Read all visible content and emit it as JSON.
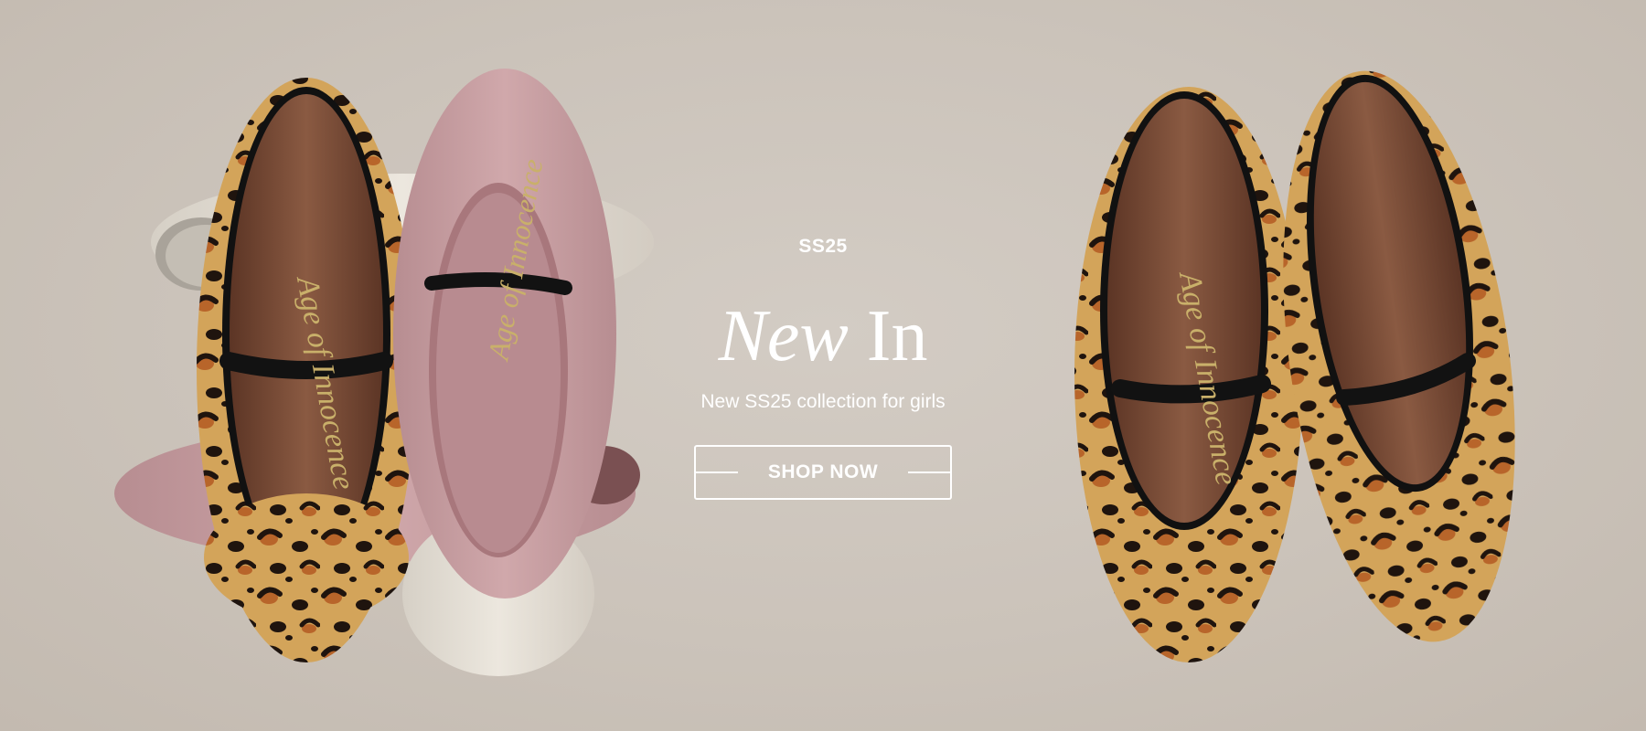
{
  "hero": {
    "eyebrow": "SS25",
    "title_italic": "New",
    "title_regular": "In",
    "subtitle": "New SS25 collection for girls",
    "cta_label": "SHOP NOW",
    "insole_brand_text": "Age of Innocence"
  },
  "colors": {
    "background": "#cdc5bc",
    "text": "#ffffff",
    "leopard_base": "#d3a45a",
    "leopard_spot": "#1f140e",
    "leopard_rust": "#b8652a",
    "pink_leather": "#c99ea2",
    "cream_leather": "#e6e0d6",
    "insole": "#7a4a33"
  }
}
